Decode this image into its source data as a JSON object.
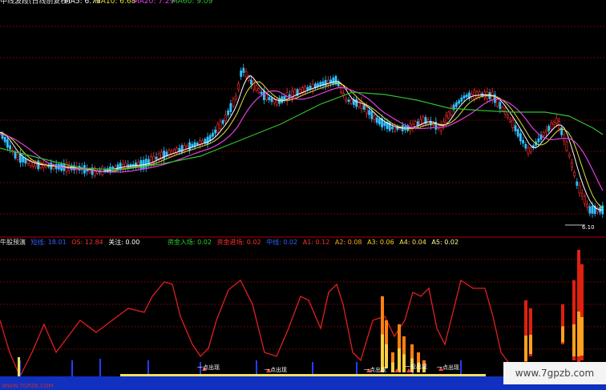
{
  "main_chart": {
    "header_label": "中线波段(日线前复权)",
    "ma5": "MA5: 6.79",
    "ma10": "MA10: 6.68",
    "ma20": "MA20: 7.29",
    "ma60": "MA60: 9.09",
    "low_price_label": "6.10",
    "colors": {
      "up": "#ff3030",
      "down": "#30c0ff",
      "ma5": "#ffffff",
      "ma10": "#e0e040",
      "ma20": "#e040e0",
      "ma60": "#30c030",
      "grid": "#7a0000"
    }
  },
  "indicator": {
    "title": "牛股预演",
    "item1": "短线: 18.01",
    "item2": "OS: 12.84",
    "item3": "关注: 0.00",
    "item4": "资金入场: 0.02",
    "item5": "资金进场: 0.02",
    "item6": "中线: 0.02",
    "item7": "A1: 0.12",
    "item8": "A2: 0.08",
    "item9": "A3: 0.06",
    "item10": "A4: 0.04",
    "item11": "A5: 0.02",
    "signal_label": "一点出现",
    "signal_label_2": "一股出现"
  },
  "watermark": {
    "text": "www.7gpzb.com",
    "small": "WWW.7GPZB.COM"
  }
}
